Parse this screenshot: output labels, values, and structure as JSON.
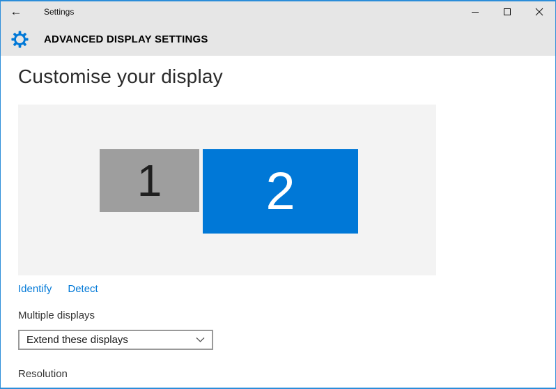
{
  "window": {
    "title": "Settings",
    "icons": {
      "back": "←"
    }
  },
  "header": {
    "title": "ADVANCED DISPLAY SETTINGS"
  },
  "main": {
    "heading": "Customise your display",
    "preview": {
      "monitors": [
        {
          "number": "1",
          "color": "#9e9e9e",
          "number_color": "#1f1f1f",
          "selected": false
        },
        {
          "number": "2",
          "color": "#0078d7",
          "number_color": "#ffffff",
          "selected": true
        }
      ]
    },
    "links": {
      "identify": "Identify",
      "detect": "Detect"
    },
    "multiple_displays": {
      "label": "Multiple displays",
      "selected_option": "Extend these displays"
    },
    "resolution": {
      "label": "Resolution"
    }
  },
  "colors": {
    "accent": "#0078d7",
    "window_border": "#2b8dd9",
    "header_bg": "#e6e6e6",
    "preview_bg": "#f3f3f3",
    "link": "#0078d7",
    "monitor_gray": "#9e9e9e",
    "dropdown_border": "#999999"
  }
}
